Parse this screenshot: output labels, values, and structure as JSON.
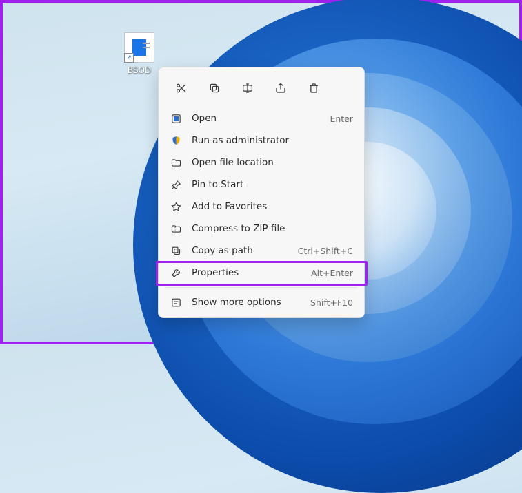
{
  "desktop": {
    "icon_label": "BSOD"
  },
  "menu": {
    "items": [
      {
        "id": "open",
        "label": "Open",
        "shortcut": "Enter"
      },
      {
        "id": "runadmin",
        "label": "Run as administrator",
        "shortcut": ""
      },
      {
        "id": "openloc",
        "label": "Open file location",
        "shortcut": ""
      },
      {
        "id": "pin",
        "label": "Pin to Start",
        "shortcut": ""
      },
      {
        "id": "fav",
        "label": "Add to Favorites",
        "shortcut": ""
      },
      {
        "id": "zip",
        "label": "Compress to ZIP file",
        "shortcut": ""
      },
      {
        "id": "copypath",
        "label": "Copy as path",
        "shortcut": "Ctrl+Shift+C"
      },
      {
        "id": "props",
        "label": "Properties",
        "shortcut": "Alt+Enter"
      },
      {
        "id": "more",
        "label": "Show more options",
        "shortcut": "Shift+F10"
      }
    ]
  }
}
